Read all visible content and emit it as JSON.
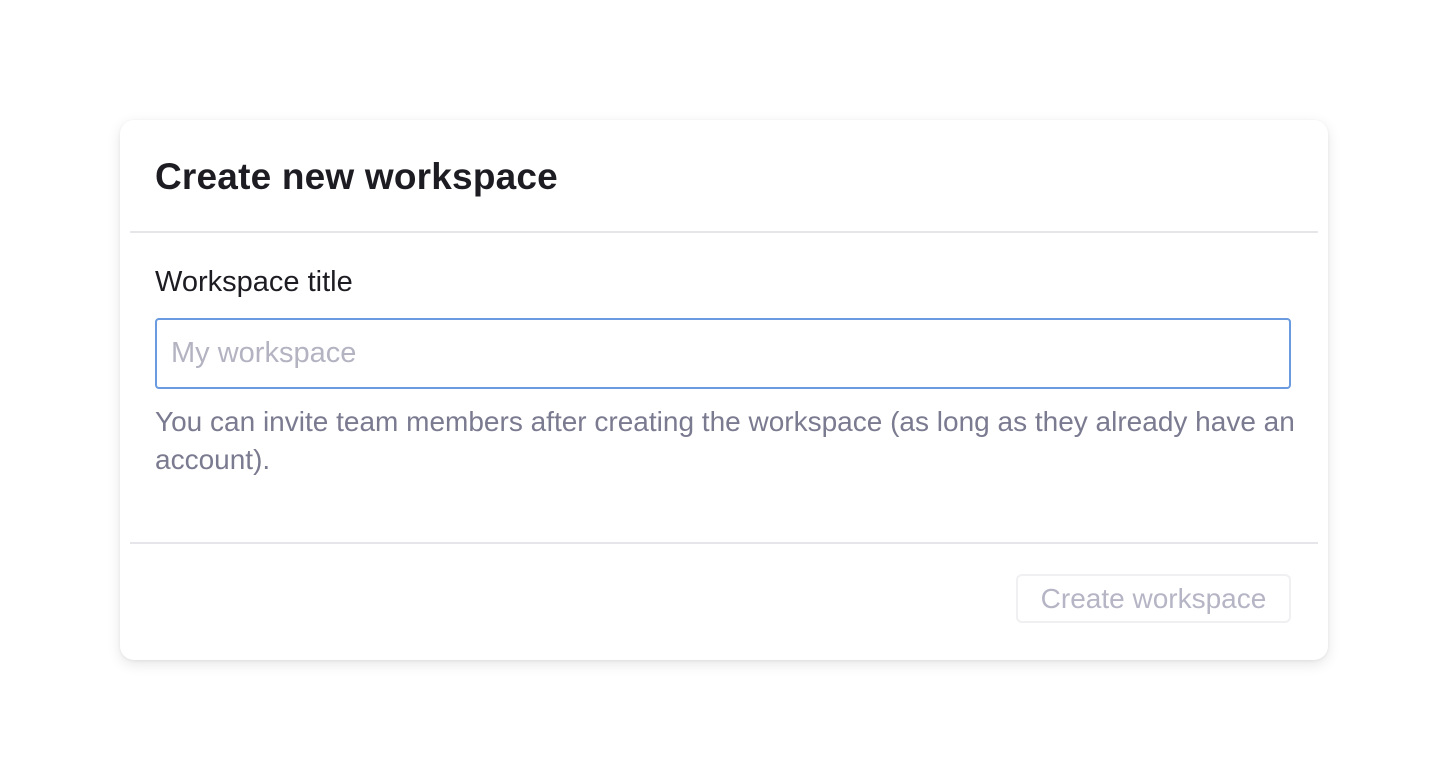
{
  "dialog": {
    "title": "Create new workspace",
    "field_label": "Workspace title",
    "input_value": "",
    "input_placeholder": "My workspace",
    "help_text": "You can invite team members after creating the workspace (as long as they already have an account).",
    "submit_label": "Create workspace",
    "submit_disabled": true
  },
  "colors": {
    "title_text": "#1c1c22",
    "input_focus_border": "#6a9ae0",
    "help_text": "#7a7a90",
    "placeholder_text": "#b3b3c2",
    "disabled_button_text": "#b5b5c6",
    "divider": "#e6e6ea"
  }
}
